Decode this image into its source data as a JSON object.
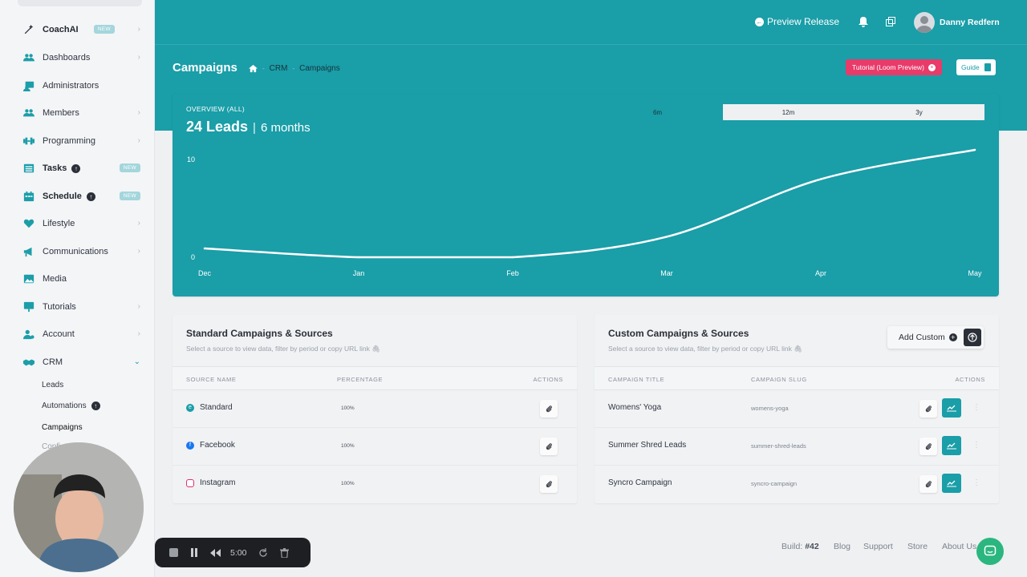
{
  "sidebar": {
    "items": [
      {
        "label": "CoachAI",
        "icon": "magic-wand-icon",
        "badge": "NEW"
      },
      {
        "label": "Dashboards",
        "icon": "users-icon"
      },
      {
        "label": "Administrators",
        "icon": "admin-icon"
      },
      {
        "label": "Members",
        "icon": "members-icon"
      },
      {
        "label": "Programming",
        "icon": "dumbbell-icon"
      },
      {
        "label": "Tasks",
        "icon": "list-icon",
        "badge": "NEW"
      },
      {
        "label": "Schedule",
        "icon": "calendar-icon",
        "badge": "NEW"
      },
      {
        "label": "Lifestyle",
        "icon": "heart-icon"
      },
      {
        "label": "Communications",
        "icon": "megaphone-icon"
      },
      {
        "label": "Media",
        "icon": "image-icon"
      },
      {
        "label": "Tutorials",
        "icon": "presentation-icon"
      },
      {
        "label": "Account",
        "icon": "user-gear-icon"
      },
      {
        "label": "CRM",
        "icon": "handshake-icon"
      }
    ],
    "crm_sub": [
      "Leads",
      "Automations",
      "Campaigns",
      "Confi"
    ]
  },
  "topbar": {
    "preview_label": "Preview Release",
    "user_name": "Danny Redfern"
  },
  "page": {
    "title": "Campaigns",
    "breadcrumb": [
      "CRM",
      "Campaigns"
    ],
    "tutorial_label": "Tutorial (Loom Preview)",
    "guide_label": "Guide"
  },
  "overview": {
    "label": "OVERVIEW (ALL)",
    "leads": "24 Leads",
    "separator": "|",
    "period": "6 months",
    "ranges": [
      "6m",
      "12m",
      "3y"
    ],
    "selected_range": "6m"
  },
  "chart_data": {
    "type": "line",
    "x": [
      "Dec",
      "Jan",
      "Feb",
      "Mar",
      "Apr",
      "May"
    ],
    "y_ticks": [
      0,
      10
    ],
    "ylim": [
      0,
      11
    ],
    "series": [
      {
        "values": [
          0.9,
          0.0,
          0.0,
          2.1,
          8.0,
          11.0
        ]
      }
    ],
    "grid": false,
    "line_color": "#ffffff"
  },
  "standard": {
    "title": "Standard Campaigns & Sources",
    "subtitle": "Select a source to view data, filter by period or copy URL link",
    "columns": [
      "SOURCE NAME",
      "PERCENTAGE",
      "ACTIONS"
    ],
    "rows": [
      {
        "name": "Standard",
        "percentage": "100%",
        "icon": "edge-icon",
        "color": "#1a9ea8"
      },
      {
        "name": "Facebook",
        "percentage": "100%",
        "icon": "facebook-icon",
        "color": "#1877f2"
      },
      {
        "name": "Instagram",
        "percentage": "100%",
        "icon": "instagram-icon",
        "color": "#e1306c"
      }
    ]
  },
  "custom": {
    "title": "Custom Campaigns & Sources",
    "subtitle": "Select a source to view data, filter by period or copy URL link",
    "add_label": "Add Custom",
    "columns": [
      "CAMPAIGN TITLE",
      "CAMPAIGN SLUG",
      "ACTIONS"
    ],
    "rows": [
      {
        "title": "Womens' Yoga",
        "slug": "womens-yoga"
      },
      {
        "title": "Summer Shred Leads",
        "slug": "summer-shred-leads"
      },
      {
        "title": "Syncro Campaign",
        "slug": "syncro-campaign"
      }
    ]
  },
  "footer": {
    "build_label": "Build:",
    "build_number": "#42",
    "links": [
      "Blog",
      "Support",
      "Store",
      "About Us"
    ]
  },
  "recorder": {
    "time": "5:00"
  },
  "colors": {
    "accent": "#1a9ea8",
    "tutorial": "#e83b6a",
    "chat": "#2bb67f"
  }
}
